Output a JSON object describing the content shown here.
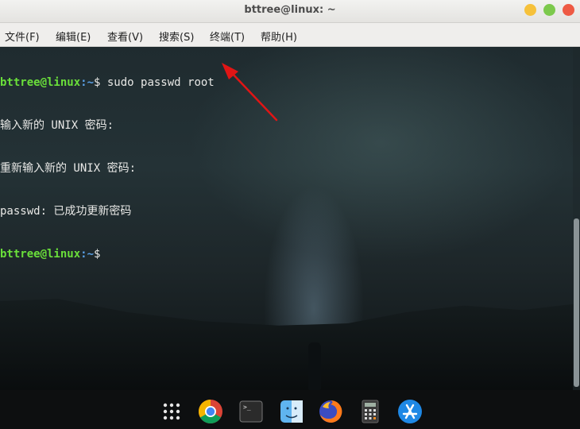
{
  "window": {
    "title": "bttree@linux: ~"
  },
  "menubar": {
    "items": [
      {
        "label": "文件(F)"
      },
      {
        "label": "编辑(E)"
      },
      {
        "label": "查看(V)"
      },
      {
        "label": "搜索(S)"
      },
      {
        "label": "终端(T)"
      },
      {
        "label": "帮助(H)"
      }
    ]
  },
  "terminal": {
    "line1": {
      "user": "bttree@linux",
      "path": ":~",
      "command": "$ sudo passwd root"
    },
    "line2": "输入新的 UNIX 密码:",
    "line3": "重新输入新的 UNIX 密码:",
    "line4": "passwd: 已成功更新密码",
    "line5": {
      "user": "bttree@linux",
      "path": ":~",
      "command": "$"
    }
  },
  "colors": {
    "prompt_user": "#6adf3a",
    "prompt_path": "#5aa0e6",
    "annotation_arrow": "#e01515"
  },
  "dock": {
    "icons": [
      "app-grid-icon",
      "chrome-icon",
      "terminal-icon",
      "finder-icon",
      "firefox-icon",
      "calculator-icon",
      "app-store-icon"
    ]
  }
}
